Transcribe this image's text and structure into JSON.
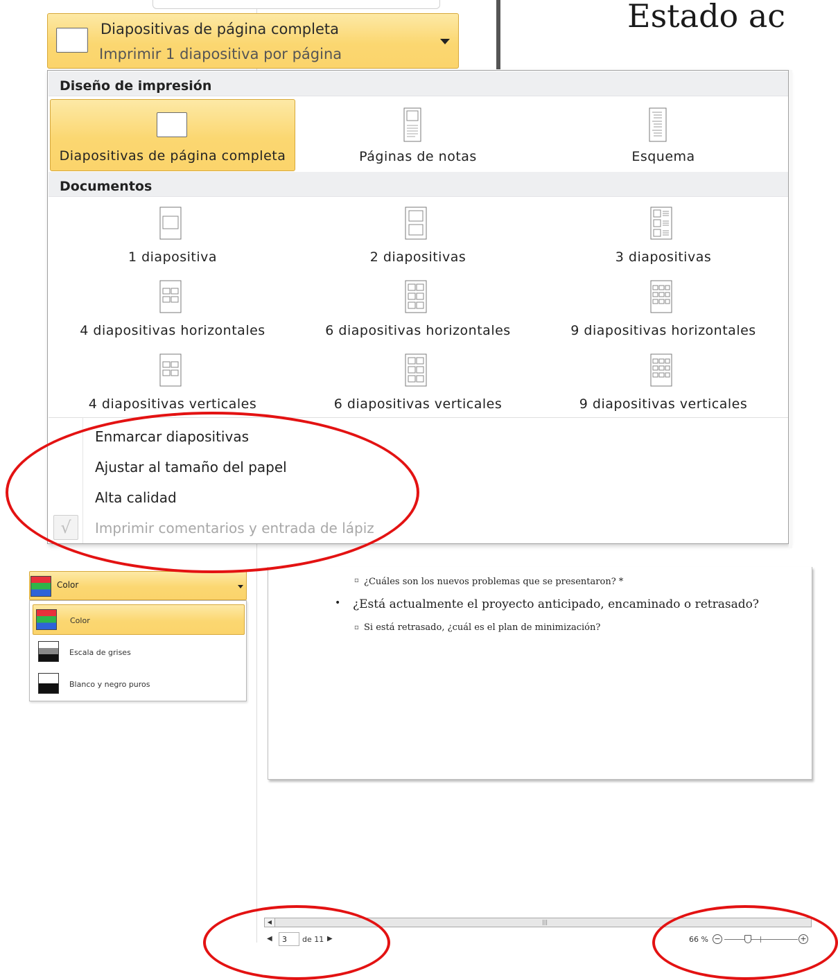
{
  "layout_dropdown": {
    "title": "Diapositivas de página completa",
    "subtitle": "Imprimir 1 diapositiva por página"
  },
  "preview": {
    "slide_heading": "Estado actual",
    "bullets": [
      "¿Cuáles son los nuevos problemas que se presentaron? *",
      "¿Está actualmente el proyecto anticipado, encaminado o retrasado?",
      "Si está retrasado, ¿cuál es el plan de minimización?"
    ]
  },
  "layout_menu": {
    "print_layout_header": "Diseño de impresión",
    "print_layouts": [
      {
        "label": "Diapositivas de página completa",
        "icon": "full-page-slide-icon",
        "selected": true
      },
      {
        "label": "Páginas de notas",
        "icon": "notes-page-icon",
        "selected": false
      },
      {
        "label": "Esquema",
        "icon": "outline-icon",
        "selected": false
      }
    ],
    "handouts_header": "Documentos",
    "handouts": [
      {
        "label": "1 diapositiva",
        "icon": "handout-1-icon"
      },
      {
        "label": "2 diapositivas",
        "icon": "handout-2-icon"
      },
      {
        "label": "3 diapositivas",
        "icon": "handout-3-icon"
      },
      {
        "label": "4 diapositivas horizontales",
        "icon": "handout-4h-icon"
      },
      {
        "label": "6 diapositivas horizontales",
        "icon": "handout-6h-icon"
      },
      {
        "label": "9 diapositivas horizontales",
        "icon": "handout-9h-icon"
      },
      {
        "label": "4 diapositivas verticales",
        "icon": "handout-4v-icon"
      },
      {
        "label": "6 diapositivas verticales",
        "icon": "handout-6v-icon"
      },
      {
        "label": "9 diapositivas verticales",
        "icon": "handout-9v-icon"
      }
    ],
    "options": [
      {
        "label": "Enmarcar diapositivas",
        "enabled": true,
        "checked": false
      },
      {
        "label": "Ajustar al tamaño del papel",
        "enabled": true,
        "checked": false
      },
      {
        "label": "Alta calidad",
        "enabled": true,
        "checked": false
      },
      {
        "label": "Imprimir comentarios y entrada de lápiz",
        "enabled": false,
        "checked": true
      }
    ],
    "checkmark": "√"
  },
  "color_dropdown": {
    "selected": "Color",
    "options": [
      {
        "label": "Color",
        "icon": "color-icon",
        "selected": true
      },
      {
        "label": "Escala de grises",
        "icon": "grayscale-icon",
        "selected": false
      },
      {
        "label": "Blanco y negro puros",
        "icon": "pure-black-white-icon",
        "selected": false
      }
    ]
  },
  "status_bar": {
    "current_page": "3",
    "total_pages": "de 11",
    "zoom": "66 %",
    "zoom_level_percent": 66
  },
  "colors": {
    "selected_highlight": "#fbd771",
    "selected_border": "#d7a83a",
    "annotation_red": "#e31212",
    "section_header_bg": "#eeeff1"
  }
}
